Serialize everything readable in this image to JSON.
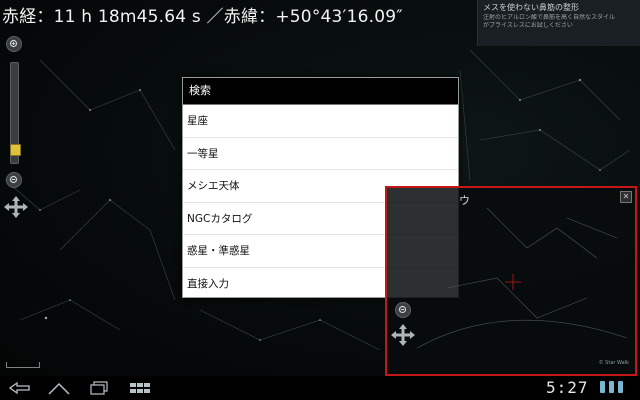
{
  "coords": {
    "text": "赤経：11 h 18m45.64 s ／赤緯：+50°43′16.09″"
  },
  "ad": {
    "title": "メスを使わない鼻筋の整形",
    "lines": [
      "注射のヒアルロン酸で鼻筋を高く自然なスタイル",
      "がプライスレスにお試しください"
    ]
  },
  "zoom": {
    "level_fraction": 0.9
  },
  "menu": {
    "title": "検索",
    "items": [
      {
        "label": "星座"
      },
      {
        "label": "一等星"
      },
      {
        "label": "メシエ天体"
      },
      {
        "label": "NGCカタログ"
      },
      {
        "label": "惑星・準惑星"
      },
      {
        "label": "直接入力"
      }
    ]
  },
  "mini_view": {
    "label": "ウ",
    "close_label": "✕",
    "credit": "© Star Walk"
  },
  "status_bar": {
    "clock": "5:27"
  },
  "colors": {
    "menu_bg": "#ffffff",
    "menu_header_bg": "#000000",
    "mini_view_border": "#c41818",
    "zoom_knob": "#e0c23a",
    "status_icons": "#7ab6cf"
  },
  "icons": {
    "zoom_in": "zoom-in-icon",
    "zoom_out": "zoom-out-icon",
    "pan": "pan-arrows-icon",
    "back": "back-icon",
    "home": "home-icon",
    "recent": "recent-apps-icon",
    "menu": "grid-menu-icon"
  }
}
